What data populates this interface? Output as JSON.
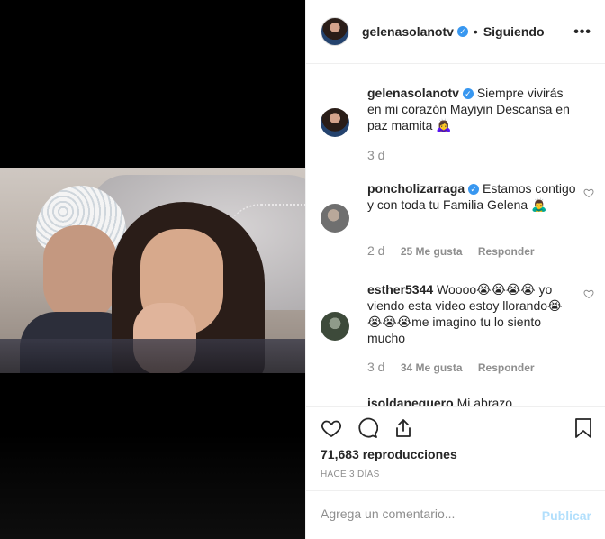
{
  "post": {
    "username": "gelenasolanotv",
    "follow_status": "Siguiendo",
    "separator": "•",
    "more_label": "•••",
    "verified_glyph": "✓"
  },
  "comments": [
    {
      "username": "gelenasolanotv",
      "text": "Siempre vivirás en mi corazón Mayiyin Descansa en paz mamita 🙇‍♀️",
      "age": "3 d"
    },
    {
      "username": "poncholizarraga",
      "text": "Estamos contigo y con toda tu Familia Gelena 🙇‍♂️",
      "age": "2 d",
      "likes": "25 Me gusta",
      "reply": "Responder"
    },
    {
      "username": "esther5344",
      "text": "Woooo😭😭😭😭 yo viendo esta video estoy llorando😭😭😭😭me imagino tu lo siento mucho",
      "age": "3 d",
      "likes": "34 Me gusta",
      "reply": "Responder"
    },
    {
      "username": "isoldaneguero",
      "text": "Mi abrazo"
    }
  ],
  "actions": {
    "views": "71,683 reproducciones",
    "ago": "HACE 3 DÍAS"
  },
  "add_comment": {
    "placeholder": "Agrega un comentario...",
    "publish": "Publicar"
  },
  "icons": [
    "more-options-icon",
    "verified-icon",
    "heart-icon",
    "comment-icon",
    "share-icon",
    "bookmark-icon"
  ],
  "colors": {
    "verified": "#3897f0",
    "publish_disabled": "#b2dffc",
    "muted": "#8e8e8e"
  }
}
